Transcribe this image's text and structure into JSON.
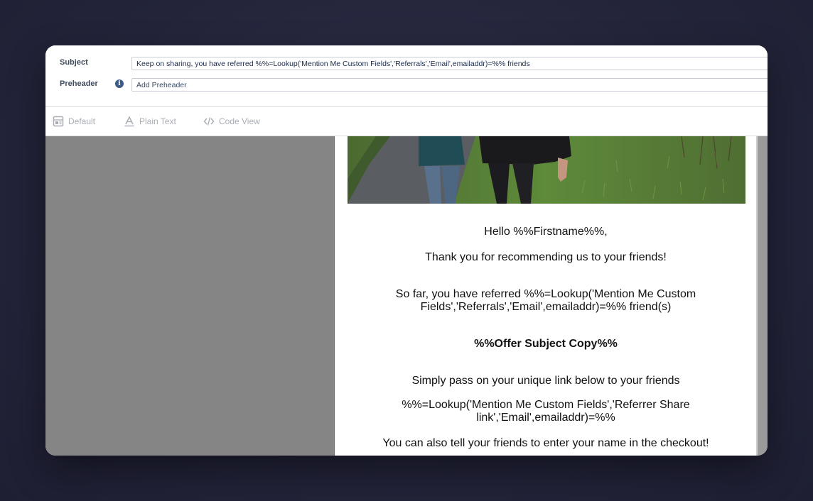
{
  "fields": {
    "subject_label": "Subject",
    "subject_value": "Keep on sharing, you have referred %%=Lookup('Mention Me Custom Fields','Referrals','Email',emailaddr)=%% friends",
    "preheader_label": "Preheader",
    "preheader_placeholder": "Add Preheader",
    "info_icon_glyph": "i"
  },
  "toolbar": {
    "default_label": "Default",
    "plain_text_label": "Plain Text",
    "code_view_label": "Code View"
  },
  "email": {
    "greeting": "Hello %%Firstname%%,",
    "thanks": "Thank you for recommending us to your friends!",
    "referred_line1": "So far, you have referred %%=Lookup('Mention Me Custom",
    "referred_line2": "Fields','Referrals','Email',emailaddr)=%% friend(s)",
    "offer": "%%Offer Subject Copy%%",
    "pass_on": "Simply pass on your unique link below to your friends",
    "link_line1": "%%=Lookup('Mention Me Custom Fields','Referrer Share",
    "link_line2": "link','Email',emailaddr)=%%",
    "checkout": "You can also tell your friends to enter your name in the checkout!"
  },
  "colors": {
    "backdrop": "#262740",
    "canvas": "#858585",
    "label": "#3e4a5c",
    "toolbar_disabled": "#a9adb5"
  },
  "icons": {
    "default": "layout-icon",
    "plain_text": "text-a-icon",
    "code_view": "code-icon",
    "preheader_info": "info-icon"
  }
}
